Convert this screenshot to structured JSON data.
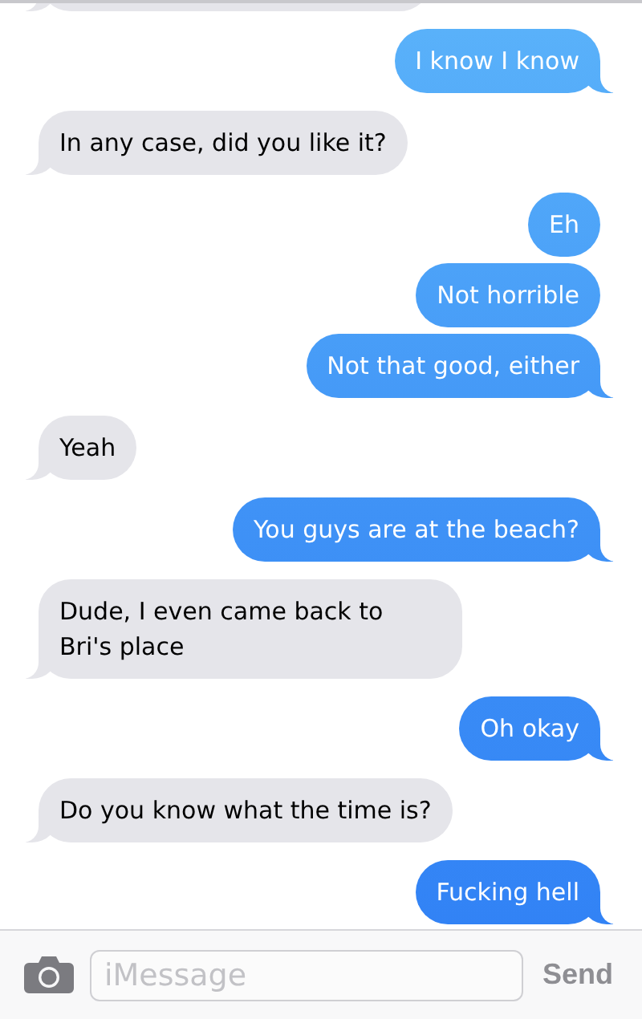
{
  "messages": [
    {
      "kind": "received"
    },
    {
      "kind": "sent",
      "text": "I know I know"
    },
    {
      "kind": "received",
      "text": "In any case, did you like it?"
    },
    {
      "kind": "sent",
      "text": "Eh"
    },
    {
      "kind": "sent",
      "text": "Not horrible"
    },
    {
      "kind": "sent",
      "text": "Not that good, either"
    },
    {
      "kind": "received",
      "text": "Yeah"
    },
    {
      "kind": "sent",
      "text": "You guys are at the beach?"
    },
    {
      "kind": "received",
      "text": "Dude, I even came back to Bri's place"
    },
    {
      "kind": "sent",
      "text": "Oh okay"
    },
    {
      "kind": "received",
      "text": "Do you know what the time is?"
    },
    {
      "kind": "sent",
      "text": "Fucking hell"
    }
  ],
  "composer": {
    "placeholder": "iMessage",
    "send": "Send"
  }
}
